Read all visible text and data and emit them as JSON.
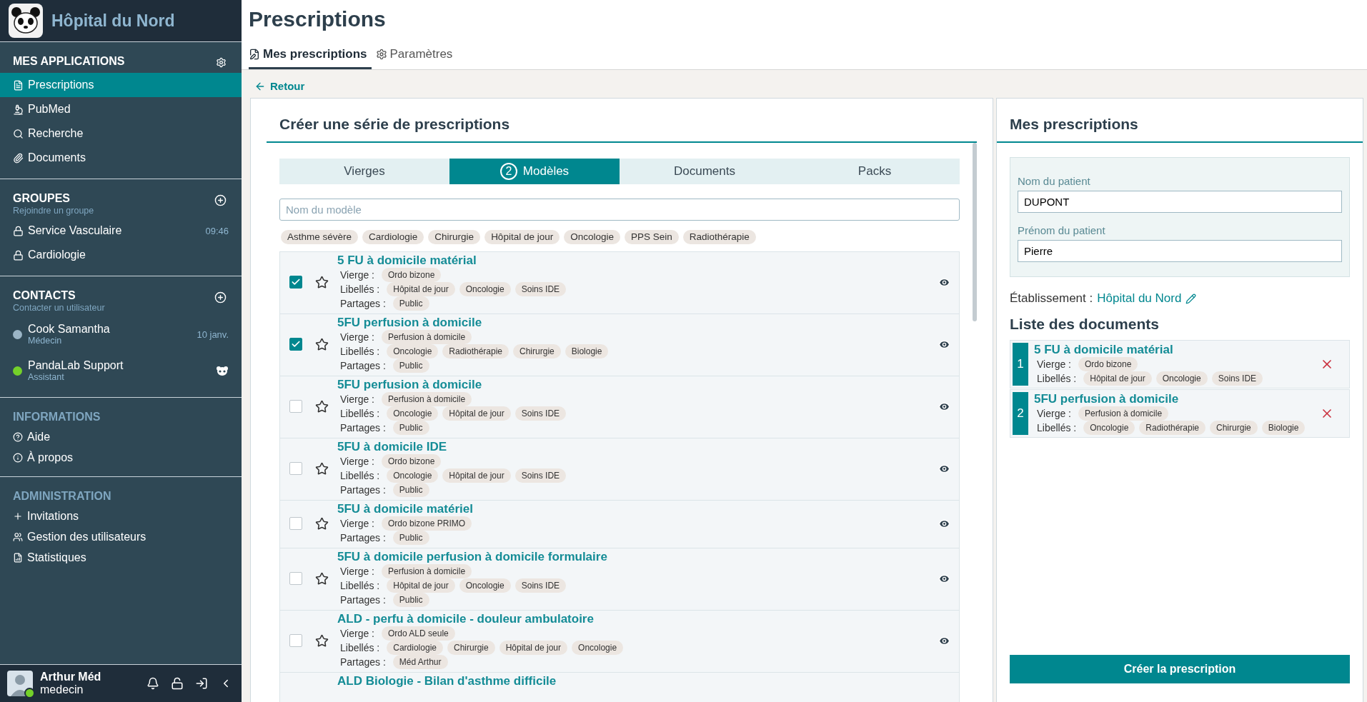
{
  "sidebar": {
    "title": "Hôpital du Nord",
    "applications": {
      "heading": "MES APPLICATIONS",
      "items": [
        {
          "label": "Prescriptions",
          "selected": true
        },
        {
          "label": "PubMed",
          "selected": false
        },
        {
          "label": "Recherche",
          "selected": false
        },
        {
          "label": "Documents",
          "selected": false
        }
      ]
    },
    "groups": {
      "heading": "GROUPES",
      "subtitle": "Rejoindre un groupe",
      "items": [
        {
          "label": "Service Vasculaire",
          "time": "09:46"
        },
        {
          "label": "Cardiologie"
        }
      ]
    },
    "contacts": {
      "heading": "CONTACTS",
      "subtitle": "Contacter un utilisateur",
      "items": [
        {
          "name": "Cook Samantha",
          "role": "Médecin",
          "time": "10 janv.",
          "color": "#9bb5c6"
        },
        {
          "name": "PandaLab Support",
          "role": "Assistant",
          "color": "#74d12a"
        }
      ]
    },
    "informations": {
      "heading": "INFORMATIONS",
      "items": [
        "Aide",
        "À propos"
      ]
    },
    "administration": {
      "heading": "ADMINISTRATION",
      "items": [
        "Invitations",
        "Gestion des utilisateurs",
        "Statistiques"
      ]
    },
    "user": {
      "name": "Arthur Méd",
      "role": "medecin",
      "online": true
    }
  },
  "page": {
    "title": "Prescriptions",
    "tabs": [
      {
        "label": "Mes prescriptions",
        "selected": true
      },
      {
        "label": "Paramètres",
        "selected": false
      }
    ],
    "back": "Retour"
  },
  "creator": {
    "title": "Créer une série de prescriptions",
    "tabs": [
      {
        "label": "Vierges",
        "selected": false
      },
      {
        "label": "Modèles",
        "selected": true,
        "badge": "2"
      },
      {
        "label": "Documents",
        "selected": false
      },
      {
        "label": "Packs",
        "selected": false
      }
    ],
    "search": {
      "placeholder": "Nom du modèle"
    },
    "filters": [
      "Asthme sévère",
      "Cardiologie",
      "Chirurgie",
      "Hôpital de jour",
      "Oncologie",
      "PPS Sein",
      "Radiothérapie"
    ],
    "models": [
      {
        "title": "5 FU à domicile matérial",
        "checked": true,
        "fields": [
          {
            "label": "Vierge :",
            "tags": [
              "Ordo bizone"
            ]
          },
          {
            "label": "Libellés :",
            "tags": [
              "Hôpital de jour",
              "Oncologie",
              "Soins IDE"
            ]
          },
          {
            "label": "Partages :",
            "tags": [
              "Public"
            ]
          }
        ]
      },
      {
        "title": "5FU perfusion à domicile",
        "checked": true,
        "fields": [
          {
            "label": "Vierge :",
            "tags": [
              "Perfusion à domicile"
            ]
          },
          {
            "label": "Libellés :",
            "tags": [
              "Oncologie",
              "Radiothérapie",
              "Chirurgie",
              "Biologie"
            ]
          },
          {
            "label": "Partages :",
            "tags": [
              "Public"
            ]
          }
        ]
      },
      {
        "title": "5FU perfusion à domicile",
        "checked": false,
        "fields": [
          {
            "label": "Vierge :",
            "tags": [
              "Perfusion à domicile"
            ]
          },
          {
            "label": "Libellés :",
            "tags": [
              "Oncologie",
              "Hôpital de jour",
              "Soins IDE"
            ]
          },
          {
            "label": "Partages :",
            "tags": [
              "Public"
            ]
          }
        ]
      },
      {
        "title": "5FU à domicile IDE",
        "checked": false,
        "fields": [
          {
            "label": "Vierge :",
            "tags": [
              "Ordo bizone"
            ]
          },
          {
            "label": "Libellés :",
            "tags": [
              "Oncologie",
              "Hôpital de jour",
              "Soins IDE"
            ]
          },
          {
            "label": "Partages :",
            "tags": [
              "Public"
            ]
          }
        ]
      },
      {
        "title": "5FU à domicile matériel",
        "checked": false,
        "fields": [
          {
            "label": "Vierge :",
            "tags": [
              "Ordo bizone PRIMO"
            ]
          },
          {
            "label": "Partages :",
            "tags": [
              "Public"
            ]
          }
        ]
      },
      {
        "title": "5FU à domicile perfusion à domicile formulaire",
        "checked": false,
        "fields": [
          {
            "label": "Vierge :",
            "tags": [
              "Perfusion à domicile"
            ]
          },
          {
            "label": "Libellés :",
            "tags": [
              "Hôpital de jour",
              "Oncologie",
              "Soins IDE"
            ]
          },
          {
            "label": "Partages :",
            "tags": [
              "Public"
            ]
          }
        ]
      },
      {
        "title": "ALD - perfu à domicile - douleur ambulatoire",
        "checked": false,
        "fields": [
          {
            "label": "Vierge :",
            "tags": [
              "Ordo ALD seule"
            ]
          },
          {
            "label": "Libellés :",
            "tags": [
              "Cardiologie",
              "Chirurgie",
              "Hôpital de jour",
              "Oncologie"
            ]
          },
          {
            "label": "Partages :",
            "tags": [
              "Méd Arthur"
            ]
          }
        ]
      },
      {
        "title": "ALD Biologie - Bilan d'asthme difficile"
      }
    ]
  },
  "summary": {
    "title": "Mes prescriptions",
    "fields": [
      {
        "label": "Nom du patient",
        "value": "DUPONT"
      },
      {
        "label": "Prénom du patient",
        "value": "Pierre"
      }
    ],
    "establishment": {
      "label": "Établissement :",
      "value": "Hôpital du Nord"
    },
    "list_title": "Liste des documents",
    "documents": [
      {
        "number": "1",
        "title": "5 FU à domicile matérial",
        "fields": [
          {
            "label": "Vierge :",
            "tags": [
              "Ordo bizone"
            ]
          },
          {
            "label": "Libellés :",
            "tags": [
              "Hôpital de jour",
              "Oncologie",
              "Soins IDE"
            ]
          }
        ]
      },
      {
        "number": "2",
        "title": "5FU perfusion à domicile",
        "fields": [
          {
            "label": "Vierge :",
            "tags": [
              "Perfusion à domicile"
            ]
          },
          {
            "label": "Libellés :",
            "tags": [
              "Oncologie",
              "Radiothérapie",
              "Chirurgie",
              "Biologie"
            ]
          }
        ]
      }
    ],
    "submit": "Créer la prescription"
  }
}
